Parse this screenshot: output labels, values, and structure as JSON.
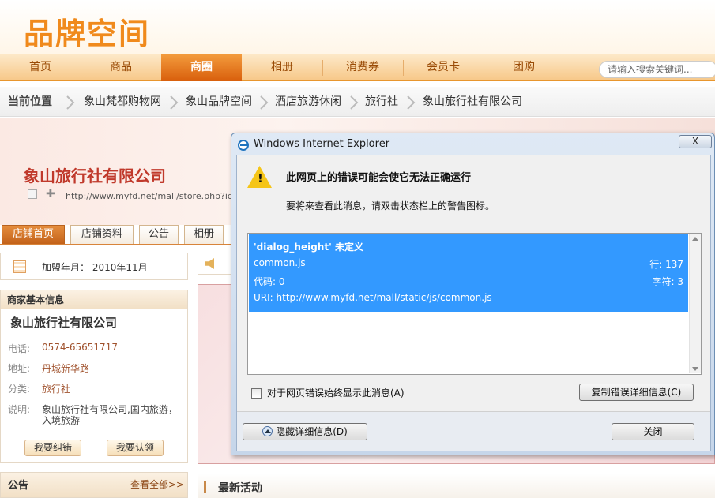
{
  "site": {
    "logo": "品牌空间"
  },
  "nav": {
    "items": [
      "首页",
      "商品",
      "商圈",
      "相册",
      "消费券",
      "会员卡",
      "团购"
    ],
    "active": "商圈",
    "search_placeholder": "请输入搜索关键词..."
  },
  "breadcrumb": {
    "label": "当前位置",
    "items": [
      "象山梵都购物网",
      "象山品牌空间",
      "酒店旅游休闲",
      "旅行社",
      "象山旅行社有限公司"
    ]
  },
  "store": {
    "name": "象山旅行社有限公司",
    "url": "http://www.myfd.net/mall/store.php?id="
  },
  "tabs": [
    "店铺首页",
    "店铺资料",
    "公告",
    "相册"
  ],
  "sidebar": {
    "join_date": "加盟年月：  2010年11月",
    "info_title": "商家基本信息",
    "biz_name": "象山旅行社有限公司",
    "rows": [
      {
        "label": "电话:",
        "value": "0574-65651717"
      },
      {
        "label": "地址:",
        "value": "丹城新华路"
      },
      {
        "label": "分类:",
        "value": "旅行社"
      },
      {
        "label": "说明:",
        "value": "象山旅行社有限公司,国内旅游，",
        "value2": "入境旅游"
      }
    ],
    "btn_correct": "我要纠错",
    "btn_claim": "我要认领",
    "notice_title": "公告",
    "notice_link": "查看全部>>"
  },
  "main": {
    "latest_title": "最新活动"
  },
  "dialog": {
    "title": "Windows Internet Explorer",
    "close": "X",
    "heading": "此网页上的错误可能会使它无法正确运行",
    "sub": "要将来查看此消息，请双击状态栏上的警告图标。",
    "error_name": "'dialog_height' 未定义",
    "file": "common.js",
    "line": "行: 137",
    "code": "代码: 0",
    "char": "字符: 3",
    "uri": "URI: http://www.myfd.net/mall/static/js/common.js",
    "checkbox_label": "对于网页错误始终显示此消息(A)",
    "copy_button": "复制错误详细信息(C)",
    "hide_button": "隐藏详细信息(D)",
    "close_button": "关闭"
  }
}
